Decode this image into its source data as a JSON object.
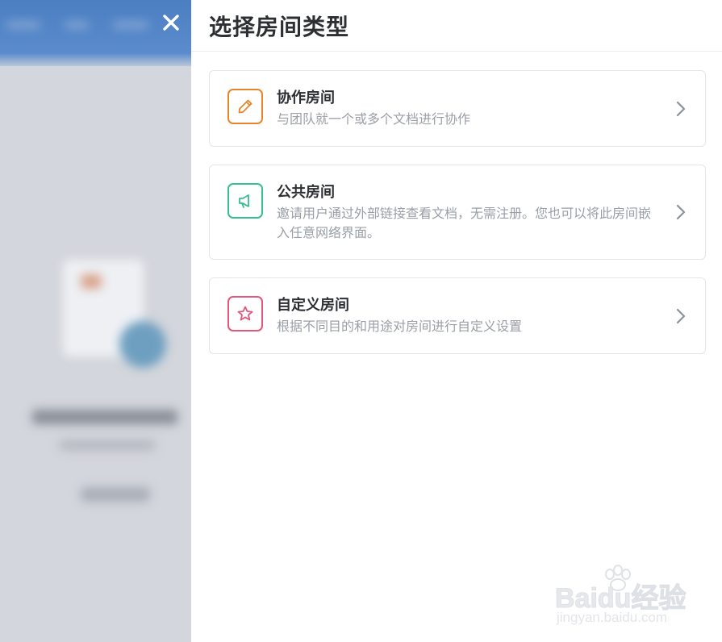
{
  "dialog": {
    "title": "选择房间类型",
    "close_icon": "close-icon"
  },
  "room_types": [
    {
      "title": "协作房间",
      "description": "与团队就一个或多个文档进行协作",
      "icon": "pencil-icon",
      "color": "#e8852a"
    },
    {
      "title": "公共房间",
      "description": "邀请用户通过外部链接查看文档，无需注册。您也可以将此房间嵌入任意网络界面。",
      "icon": "megaphone-icon",
      "color": "#35bf8e"
    },
    {
      "title": "自定义房间",
      "description": "根据不同目的和用途对房间进行自定义设置",
      "icon": "star-icon",
      "color": "#e2577c"
    }
  ],
  "watermark": {
    "main": "Baidu经验",
    "sub": "jingyan.baidu.com"
  },
  "colors": {
    "backdrop": "#d3d6dc",
    "header_blue": "#4b7fc2",
    "title_text": "#2d2f33",
    "desc_text": "#9a9ea6",
    "card_border": "#e3e5e9"
  }
}
